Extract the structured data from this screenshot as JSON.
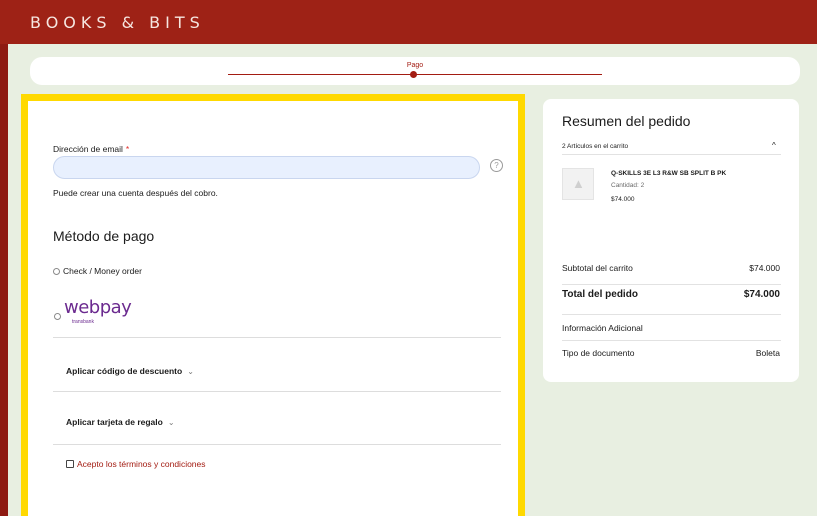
{
  "header": {
    "brand": "BOOKS & BITS"
  },
  "progress": {
    "current_step": "Pago"
  },
  "form": {
    "email_label": "Dirección de email",
    "required_mark": "*",
    "email_value": "",
    "help_symbol": "?",
    "note": "Puede crear una cuenta después del cobro.",
    "payment_title": "Método de pago",
    "methods": [
      {
        "label": "Check / Money order",
        "selected": false
      },
      {
        "label": "webpay",
        "sublabel": "transbank",
        "selected": false
      }
    ],
    "discount_label": "Aplicar código de descuento",
    "giftcard_label": "Aplicar tarjeta de regalo",
    "terms_label": "Acepto los términos y condiciones",
    "terms_checked": false
  },
  "summary": {
    "title": "Resumen del pedido",
    "items_count": "2 Artículos en el carrito",
    "toggle_symbol": "^",
    "item": {
      "name": "Q-SKILLS 3E L3 R&W SB SPLIT B PK",
      "qty": "Cantidad: 2",
      "price": "$74.000"
    },
    "subtotal_label": "Subtotal del carrito",
    "subtotal_value": "$74.000",
    "total_label": "Total del pedido",
    "total_value": "$74.000",
    "info_label": "Información Adicional",
    "doc_type_label": "Tipo de documento",
    "doc_type_value": "Boleta"
  },
  "colors": {
    "brand_red": "#9e2216",
    "accent": "#a31c12",
    "highlight": "#ffd900",
    "webpay": "#6b2a8f"
  }
}
